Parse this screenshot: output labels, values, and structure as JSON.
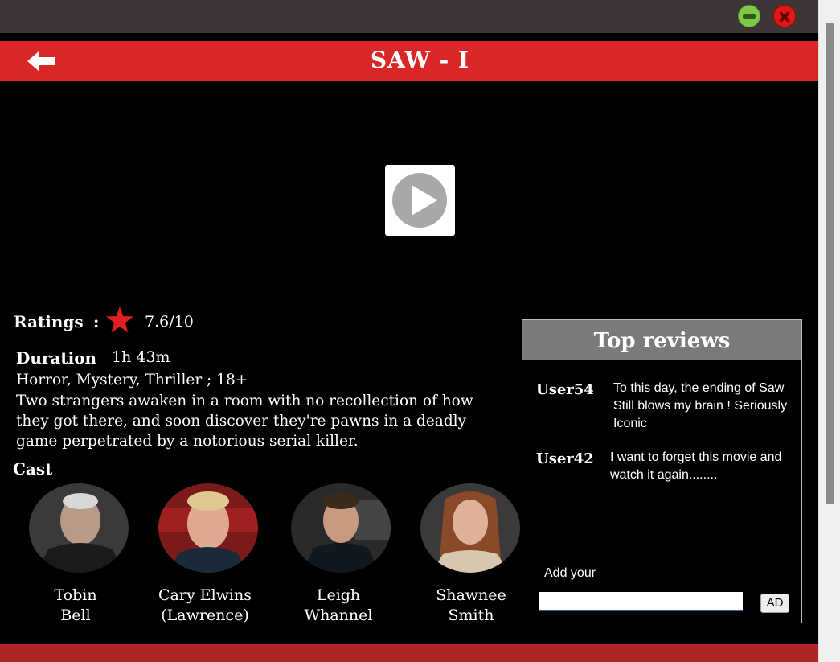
{
  "window": {
    "minimize_icon": "minimize-icon",
    "close_icon": "close-icon"
  },
  "header": {
    "back_icon": "back-arrow-icon",
    "title": "SAW - I"
  },
  "player": {
    "play_icon": "play-icon"
  },
  "info": {
    "ratings_label": "Ratings",
    "ratings_colon": ":",
    "rating_icon": "star-icon",
    "rating_value": "7.6/10",
    "duration_label": "Duration",
    "duration_value": "1h 43m",
    "genres": "Horror, Mystery, Thriller ; 18+",
    "description": "Two strangers awaken in a room with no recollection of how they got there, and soon discover they're pawns in a deadly game perpetrated by a notorious serial killer.",
    "cast_label": "Cast"
  },
  "cast": [
    {
      "line1": "Tobin",
      "line2": "Bell"
    },
    {
      "line1": "Cary Elwins",
      "line2": "(Lawrence)"
    },
    {
      "line1": "Leigh",
      "line2": "Whannel"
    },
    {
      "line1": "Shawnee",
      "line2": "Smith"
    }
  ],
  "reviews": {
    "title": "Top reviews",
    "items": [
      {
        "user": "User54",
        "text": "To this day, the ending of Saw Still blows my brain ! Seriously Iconic"
      },
      {
        "user": "User42",
        "text": "I want to forget this movie and watch it again........"
      }
    ],
    "add_label": "Add your",
    "add_button": "AD"
  },
  "colors": {
    "accent": "#d92626",
    "titlebar": "#3d3535",
    "reviews_header": "#7a7a7a"
  }
}
